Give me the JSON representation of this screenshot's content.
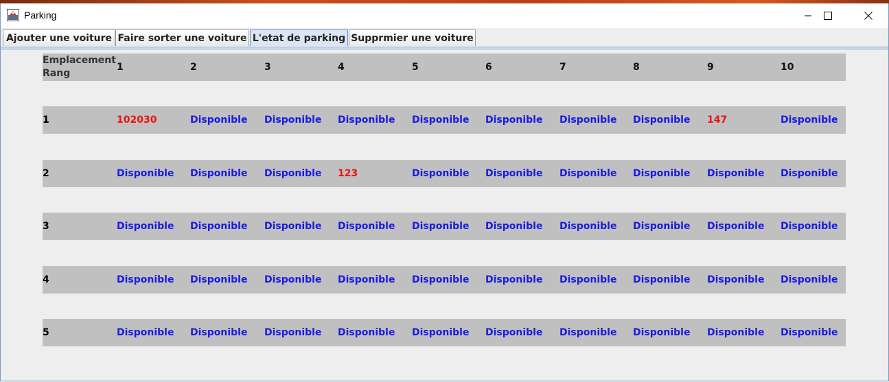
{
  "window": {
    "title": "Parking"
  },
  "tabs": [
    {
      "label": "Ajouter une voiture",
      "active": false
    },
    {
      "label": "Faire sorter une voiture",
      "active": false
    },
    {
      "label": "L'etat de parking",
      "active": true
    },
    {
      "label": "Supprmier une voiture",
      "active": false
    }
  ],
  "grid": {
    "corner_line1": "Emplacement",
    "corner_line2": "Rang",
    "columns": [
      "1",
      "2",
      "3",
      "4",
      "5",
      "6",
      "7",
      "8",
      "9",
      "10"
    ],
    "rows": [
      {
        "rank": "1",
        "cells": [
          "102030",
          "Disponible",
          "Disponible",
          "Disponible",
          "Disponible",
          "Disponible",
          "Disponible",
          "Disponible",
          "147",
          "Disponible"
        ]
      },
      {
        "rank": "2",
        "cells": [
          "Disponible",
          "Disponible",
          "Disponible",
          "123",
          "Disponible",
          "Disponible",
          "Disponible",
          "Disponible",
          "Disponible",
          "Disponible"
        ]
      },
      {
        "rank": "3",
        "cells": [
          "Disponible",
          "Disponible",
          "Disponible",
          "Disponible",
          "Disponible",
          "Disponible",
          "Disponible",
          "Disponible",
          "Disponible",
          "Disponible"
        ]
      },
      {
        "rank": "4",
        "cells": [
          "Disponible",
          "Disponible",
          "Disponible",
          "Disponible",
          "Disponible",
          "Disponible",
          "Disponible",
          "Disponible",
          "Disponible",
          "Disponible"
        ]
      },
      {
        "rank": "5",
        "cells": [
          "Disponible",
          "Disponible",
          "Disponible",
          "Disponible",
          "Disponible",
          "Disponible",
          "Disponible",
          "Disponible",
          "Disponible",
          "Disponible"
        ]
      }
    ]
  },
  "colors": {
    "available": "#1a1ae6",
    "occupied": "#ee1111",
    "row_background": "#c0c0c0"
  }
}
